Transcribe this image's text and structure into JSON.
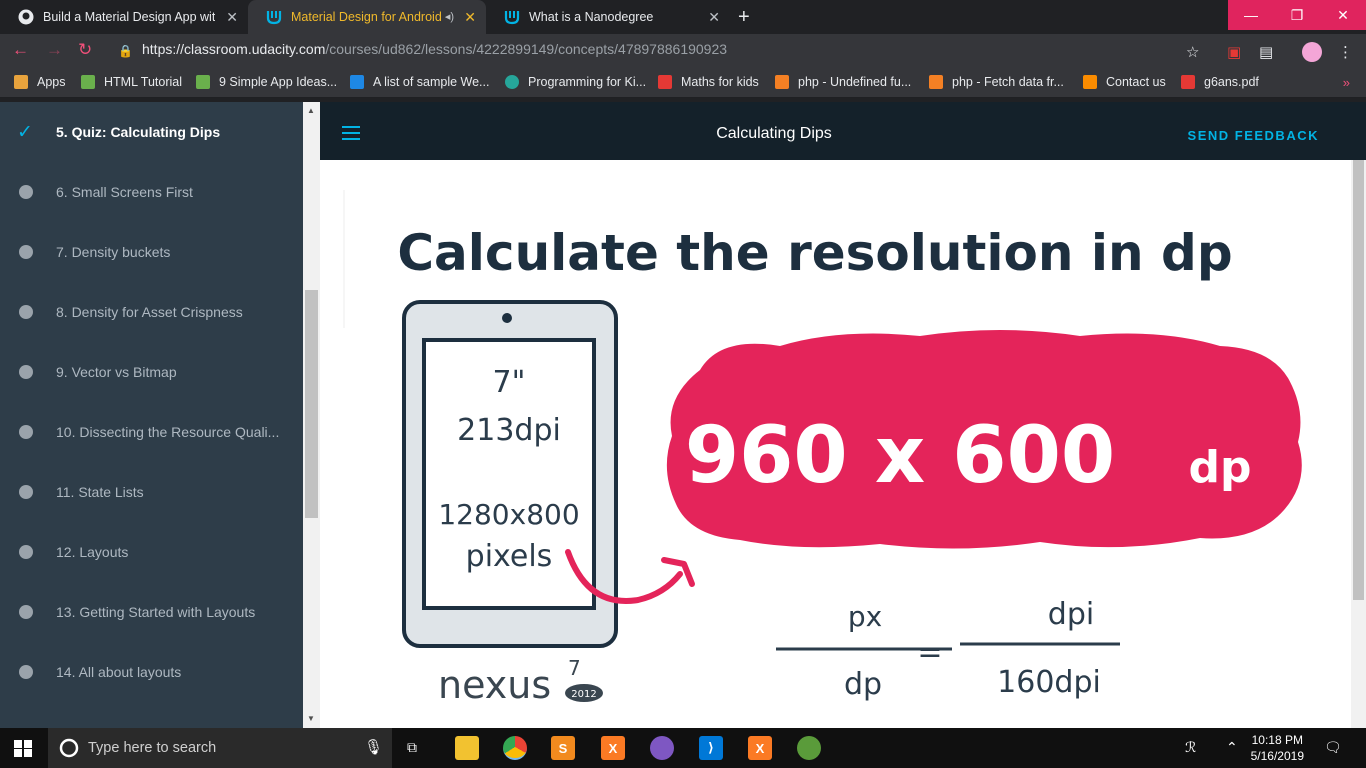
{
  "tabs": [
    {
      "title": "Build a Material Design App with",
      "icon": "github-icon"
    },
    {
      "title": "Material Design for Android",
      "icon": "udacity-icon"
    },
    {
      "title": "What is a Nanodegree",
      "icon": "udacity-icon"
    }
  ],
  "address": {
    "host": "https://classroom.udacity.com",
    "path": "/courses/ud862/lessons/4222899149/concepts/47897886190923"
  },
  "bookmarks": [
    {
      "label": "Apps",
      "color": "#e8a33d"
    },
    {
      "label": "HTML Tutorial",
      "color": "#6ab04c"
    },
    {
      "label": "9 Simple App Ideas...",
      "color": "#6ab04c"
    },
    {
      "label": "A list of sample We...",
      "color": "#1e88e5"
    },
    {
      "label": "Programming for Ki...",
      "color": "#26a69a"
    },
    {
      "label": "Maths for kids",
      "color": "#e53935"
    },
    {
      "label": "php - Undefined fu...",
      "color": "#f48024"
    },
    {
      "label": "php - Fetch data fr...",
      "color": "#f48024"
    },
    {
      "label": "Contact us",
      "color": "#fb8c00"
    },
    {
      "label": "g6ans.pdf",
      "color": "#e53935"
    }
  ],
  "sidebar": {
    "items": [
      {
        "label": "5. Quiz: Calculating Dips",
        "done": true
      },
      {
        "label": "6. Small Screens First"
      },
      {
        "label": "7. Density buckets"
      },
      {
        "label": "8. Density for Asset Crispness"
      },
      {
        "label": "9. Vector vs Bitmap"
      },
      {
        "label": "10. Dissecting the Resource Quali..."
      },
      {
        "label": "11. State Lists"
      },
      {
        "label": "12. Layouts"
      },
      {
        "label": "13. Getting Started with Layouts"
      },
      {
        "label": "14. All about layouts"
      }
    ]
  },
  "header": {
    "title": "Calculating Dips",
    "feedback": "SEND FEEDBACK"
  },
  "illustration": {
    "heading": "Calculate the resolution in dp",
    "device": {
      "size": "7\"",
      "density": "213dpi",
      "resolution": "1280x800",
      "unit": "pixels",
      "brand": "nexus",
      "superscript": "7",
      "year": "2012"
    },
    "result": {
      "value": "960 x 600",
      "unit": "dp"
    },
    "formula": {
      "left_num": "px",
      "left_den": "dp",
      "equals": "=",
      "right_num": "dpi",
      "right_den": "160dpi"
    },
    "colors": {
      "accent": "#e4245a",
      "ink": "#1d2f3f"
    }
  },
  "taskbar": {
    "search_placeholder": "Type here to search",
    "time": "10:18 PM",
    "date": "5/16/2019"
  }
}
